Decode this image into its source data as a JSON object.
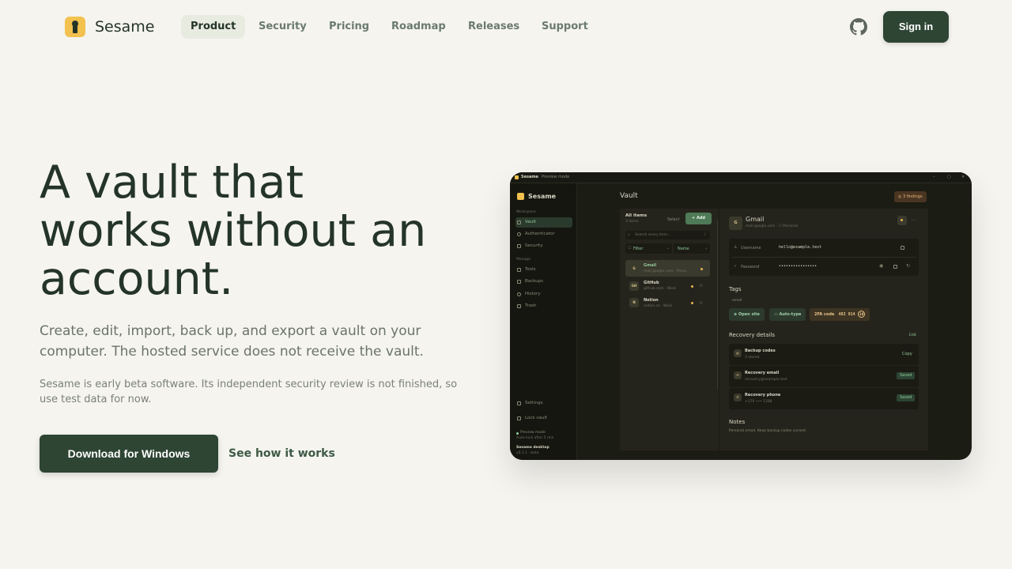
{
  "nav": {
    "brand": "Sesame",
    "items": [
      "Product",
      "Security",
      "Pricing",
      "Roadmap",
      "Releases",
      "Support"
    ],
    "active": "Product",
    "github_icon": "github-icon",
    "signin": "Sign in"
  },
  "hero": {
    "title": "A vault that works without an account.",
    "subtitle": "Create, edit, import, back up, and export a vault on your computer. The hosted service does not receive the vault.",
    "note": "Sesame is early beta software. Its independent security review is not finished, so use test data for now.",
    "download": "Download for Windows",
    "how": "See how it works"
  },
  "app": {
    "titlebar": {
      "name": "Sesame",
      "sep": "·",
      "mode": "Preview mode",
      "min": "–",
      "max": "▢",
      "close": "✕"
    },
    "sidebar": {
      "brand": "Sesame",
      "workspace": "Workspace",
      "workspace_items": [
        "Vault",
        "Authenticator",
        "Security"
      ],
      "manage": "Manage",
      "manage_items": [
        "Tools",
        "Backups",
        "History",
        "Trash"
      ],
      "settings": "Settings",
      "lock": "Lock vault",
      "preview_mode": "Preview mode",
      "autolock": "Auto-lock after 5 min",
      "desktop": "Sesame desktop",
      "version": "v0.1.1 · beta"
    },
    "header": {
      "title": "Vault",
      "findings": "3 findings"
    },
    "list": {
      "title": "All items",
      "count": "3 items",
      "select": "Select",
      "add": "+ Add",
      "search_placeholder": "Search every item...",
      "search_kbd": "/",
      "filter": "Filter",
      "sort": "Name",
      "items": [
        {
          "initials": "G",
          "name": "Gmail",
          "sub": "mail.google.com · Perso..."
        },
        {
          "initials": "GH",
          "name": "GitHub",
          "sub": "github.com · Work"
        },
        {
          "initials": "N",
          "name": "Notion",
          "sub": "notion.so · Work"
        }
      ]
    },
    "detail": {
      "initial": "G",
      "name": "Gmail",
      "sub": "mail.google.com · ☐ Personal",
      "more": "···",
      "username_label": "Username",
      "username": "hello@example.test",
      "password_label": "Password",
      "password": "••••••••••••••••",
      "tags_title": "Tags",
      "tag": "email",
      "open_site": "Open site",
      "auto_type": "Auto-type",
      "twofa_label": "2FA code",
      "twofa_code": "482 914",
      "twofa_timer": "18",
      "recovery_title": "Recovery details",
      "edit": "Edit",
      "recovery": [
        {
          "name": "Backup codes",
          "sub": "3 stored",
          "action": "Copy"
        },
        {
          "name": "Recovery email",
          "sub": "recovery@example.test",
          "action": "Saved"
        },
        {
          "name": "Recovery phone",
          "sub": "+370 ••• 1288",
          "action": "Saved"
        }
      ],
      "notes_title": "Notes",
      "notes": "Personal email. Keep backup codes current."
    }
  },
  "colors": {
    "brand_dark": "#2e4534",
    "accent_gold": "#f2c14e",
    "background": "#f5f4ef"
  }
}
